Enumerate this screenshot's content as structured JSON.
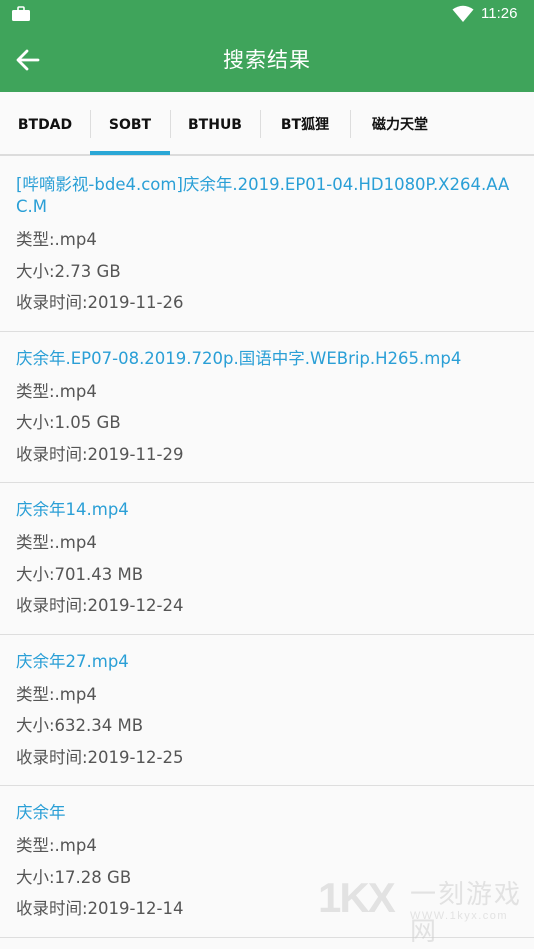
{
  "status_bar": {
    "time": "11:26",
    "icons": [
      "briefcase-icon",
      "wifi-icon",
      "battery-icon"
    ]
  },
  "app_bar": {
    "title": "搜索结果",
    "back_icon": "arrow-left-icon"
  },
  "tabs": [
    {
      "label": "BTDAD",
      "selected": false
    },
    {
      "label": "SOBT",
      "selected": true
    },
    {
      "label": "BTHUB",
      "selected": false
    },
    {
      "label": "BT狐狸",
      "selected": false
    },
    {
      "label": "磁力天堂",
      "selected": false
    }
  ],
  "results": [
    {
      "name": "[哔嘀影视-bde4.com]庆余年.2019.EP01-04.HD1080P.X264.AAC.M",
      "type": "类型:.mp4",
      "size": "大小:2.73 GB",
      "date": "收录时间:2019-11-26"
    },
    {
      "name": "庆余年.EP07-08.2019.720p.国语中字.WEBrip.H265.mp4",
      "type": "类型:.mp4",
      "size": "大小:1.05 GB",
      "date": "收录时间:2019-11-29"
    },
    {
      "name": "庆余年14.mp4",
      "type": "类型:.mp4",
      "size": "大小:701.43 MB",
      "date": "收录时间:2019-12-24"
    },
    {
      "name": "庆余年27.mp4",
      "type": "类型:.mp4",
      "size": "大小:632.34 MB",
      "date": "收录时间:2019-12-25"
    },
    {
      "name": "庆余年",
      "type": "类型:.mp4",
      "size": "大小:17.28 GB",
      "date": "收录时间:2019-12-14"
    }
  ],
  "watermark": {
    "logo": "1KX",
    "name": "一刻游戏网",
    "url": "WWW.1kyx.com"
  },
  "colors": {
    "app_bar": "#3fa45b",
    "accent": "#2aa7d6",
    "link": "#2a9fd6"
  }
}
